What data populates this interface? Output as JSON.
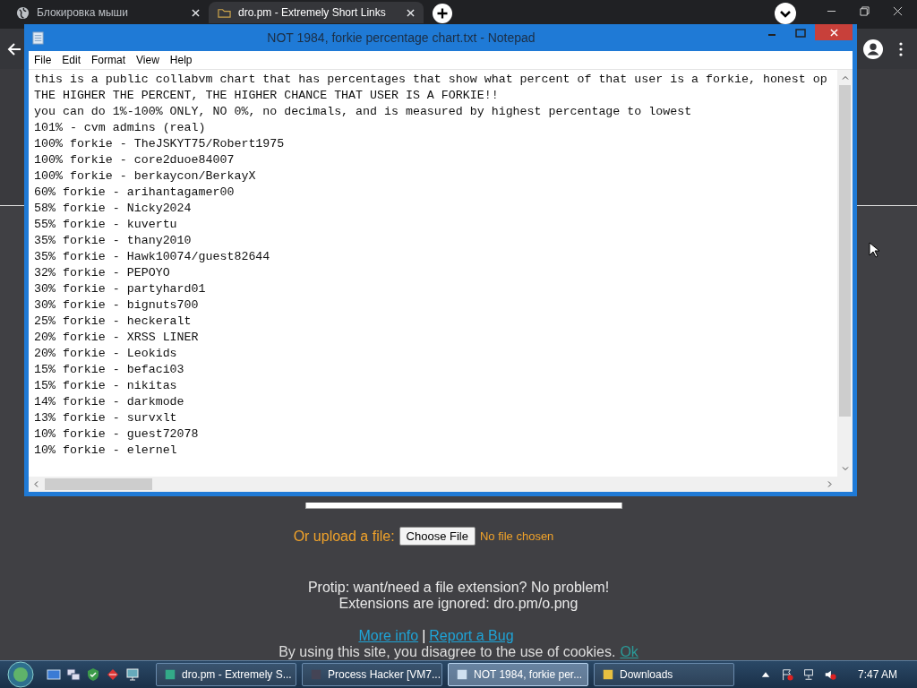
{
  "browser": {
    "tabs": [
      {
        "title": "Блокировка мыши",
        "selected": false
      },
      {
        "title": "dro.pm - Extremely Short Links",
        "selected": true
      }
    ]
  },
  "page": {
    "upload_label": "Or upload a file:",
    "file_button": "Choose File",
    "file_status": "No file chosen",
    "protip": [
      "Protip: want/need a file extension? No problem!",
      "Extensions are ignored: dro.pm/o.png"
    ],
    "links": [
      "More info",
      "Report a Bug"
    ],
    "link_separator": "|",
    "cookie_notice": "By using this site, you disagree to the use of cookies.",
    "cookie_ok": "Ok"
  },
  "notepad": {
    "title": "NOT 1984, forkie percentage chart.txt - Notepad",
    "menu": [
      "File",
      "Edit",
      "Format",
      "View",
      "Help"
    ],
    "lines": [
      "this is a public collabvm chart that has percentages that show what percent of that user is a forkie, honest op",
      "THE HIGHER THE PERCENT, THE HIGHER CHANCE THAT USER IS A FORKIE!!",
      "you can do 1%-100% ONLY, NO 0%, no decimals, and is measured by highest percentage to lowest",
      "101% - cvm admins (real)",
      "100% forkie - TheJSKYT75/Robert1975",
      "100% forkie - core2duoe84007",
      "100% forkie - berkaycon/BerkayX",
      "60% forkie - arihantagamer00",
      "58% forkie - Nicky2024",
      "55% forkie - kuvertu",
      "35% forkie - thany2010",
      "35% forkie - Hawk10074/guest82644",
      "32% forkie - PEPOYO",
      "30% forkie - partyhard01",
      "30% forkie - bignuts700",
      "25% forkie - heckeralt",
      "20% forkie - XRSS LINER",
      "20% forkie - Leokids",
      "15% forkie - befaci03",
      "15% forkie - nikitas",
      "14% forkie - darkmode",
      "13% forkie - survxlt",
      "10% forkie - guest72078",
      "10% forkie - elernel"
    ]
  },
  "taskbar": {
    "tasks": [
      {
        "label": "dro.pm - Extremely S...",
        "selected": false
      },
      {
        "label": "Process Hacker [VM7...",
        "selected": false
      },
      {
        "label": "NOT 1984, forkie per...",
        "selected": true
      },
      {
        "label": "Downloads",
        "selected": false
      }
    ],
    "clock": "7:47 AM"
  }
}
